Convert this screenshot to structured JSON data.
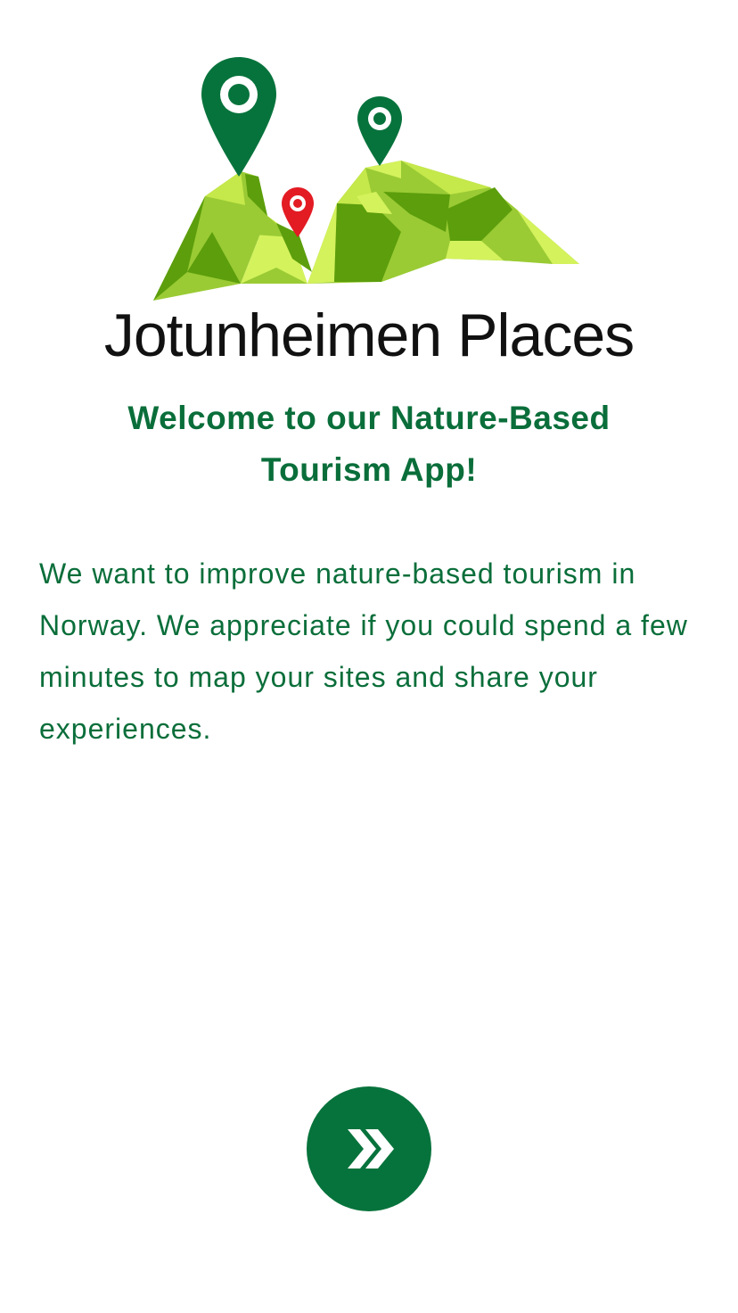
{
  "app": {
    "name": "Jotunheimen Places",
    "logo_icon": "mountain-pins-logo"
  },
  "welcome": {
    "heading": "Welcome to our Nature-Based Tourism App!",
    "body": "We want to improve nature-based tourism in Norway. We appreciate if you could spend a few minutes to map your sites and share your experiences."
  },
  "next_button": {
    "icon": "double-chevron-right-icon"
  },
  "colors": {
    "brand_green": "#07733c",
    "text_green": "#0a6e3a",
    "pin_red": "#e31b23",
    "mountain_light": "#d4f25c",
    "mountain_mid": "#9acb34",
    "mountain_dark": "#5c9e0c"
  }
}
